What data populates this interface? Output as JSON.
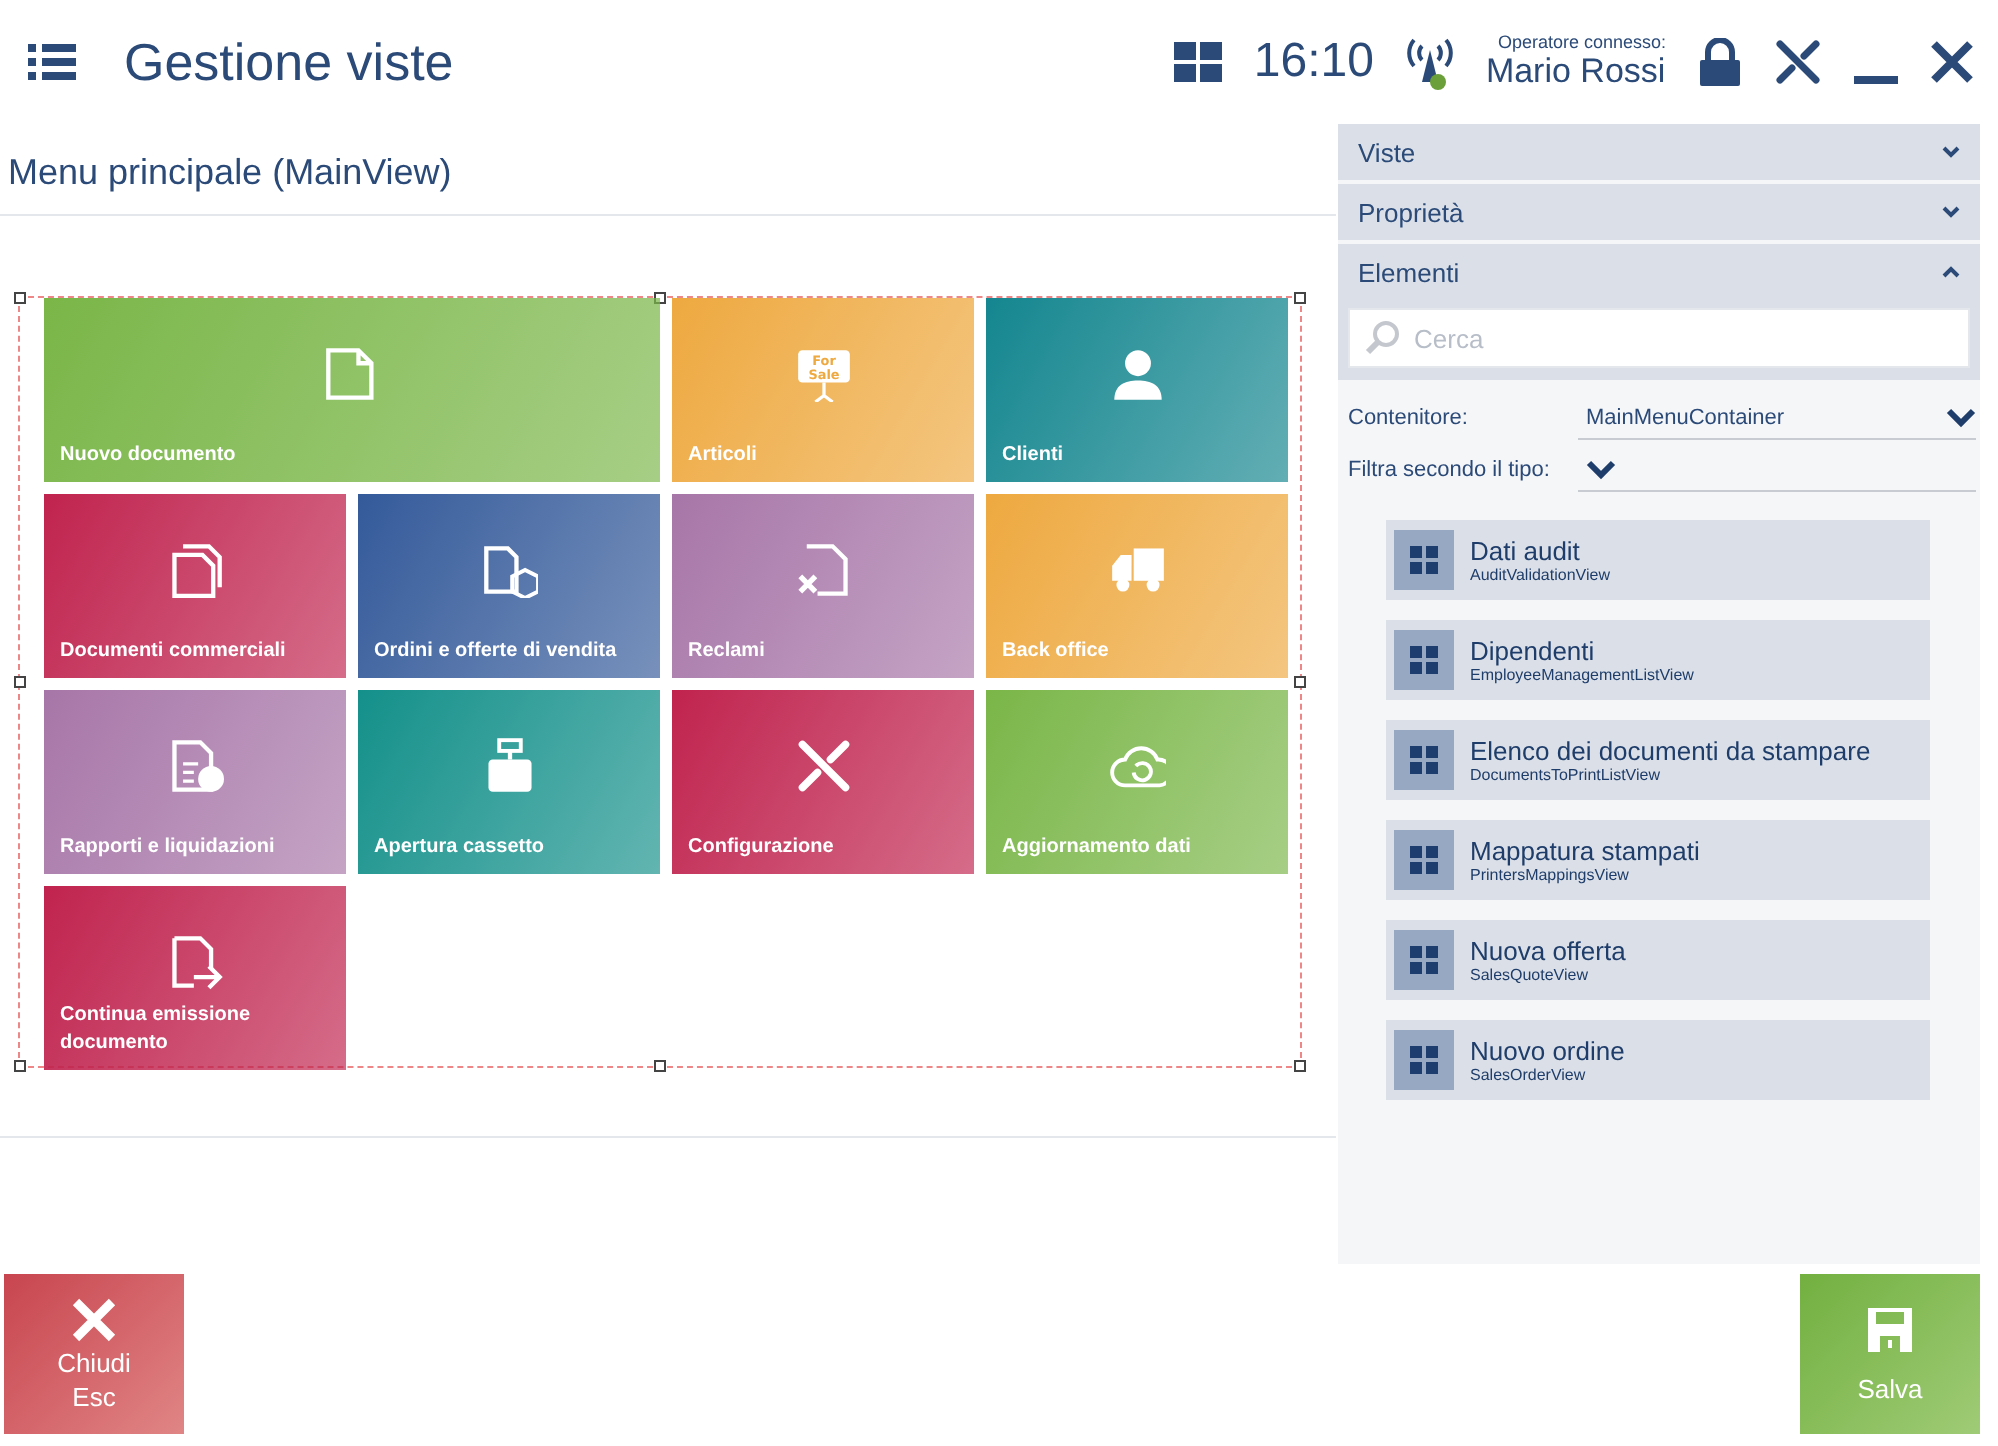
{
  "header": {
    "title": "Gestione viste",
    "time": "16:10",
    "operator_label": "Operatore connesso:",
    "operator_name": "Mario Rossi"
  },
  "view_title": "Menu principale (MainView)",
  "tiles": [
    {
      "label": "Nuovo documento",
      "color": "#7ab648",
      "wide": true
    },
    {
      "label": "Articoli",
      "color": "#eea940",
      "wide": false,
      "icon_text": "For Sale"
    },
    {
      "label": "Clienti",
      "color": "#14868f",
      "wide": false
    },
    {
      "label": "Documenti commerciali",
      "color": "#c0234e",
      "wide": false
    },
    {
      "label": "Ordini e offerte di vendita",
      "color": "#345a9a",
      "wide": false
    },
    {
      "label": "Reclami",
      "color": "#a776a8",
      "wide": false
    },
    {
      "label": "Back office",
      "color": "#eea940",
      "wide": false
    },
    {
      "label": "Rapporti e liquidazioni",
      "color": "#a776a8",
      "wide": false
    },
    {
      "label": "Apertura cassetto",
      "color": "#14908a",
      "wide": false
    },
    {
      "label": "Configurazione",
      "color": "#c0234e",
      "wide": false
    },
    {
      "label": "Aggiornamento dati",
      "color": "#7ab648",
      "wide": false
    },
    {
      "label": "Continua emissione documento",
      "color": "#c0234e",
      "wide": false
    }
  ],
  "panel": {
    "sections": [
      {
        "label": "Viste",
        "expanded": false
      },
      {
        "label": "Proprietà",
        "expanded": false
      },
      {
        "label": "Elementi",
        "expanded": true
      }
    ],
    "search": {
      "placeholder": "Cerca"
    },
    "container": {
      "label": "Contenitore:",
      "value": "MainMenuContainer"
    },
    "type_filter": {
      "label": "Filtra secondo il tipo:"
    },
    "elements": [
      {
        "title": "Dati audit",
        "subtitle": "AuditValidationView"
      },
      {
        "title": "Dipendenti",
        "subtitle": "EmployeeManagementListView"
      },
      {
        "title": "Elenco dei documenti da stampare",
        "subtitle": "DocumentsToPrintListView"
      },
      {
        "title": "Mappatura stampati",
        "subtitle": "PrintersMappingsView"
      },
      {
        "title": "Nuova offerta",
        "subtitle": "SalesQuoteView"
      },
      {
        "title": "Nuovo ordine",
        "subtitle": "SalesOrderView"
      }
    ]
  },
  "footer": {
    "close": {
      "label": "Chiudi",
      "shortcut": "Esc"
    },
    "save": {
      "label": "Salva"
    }
  }
}
